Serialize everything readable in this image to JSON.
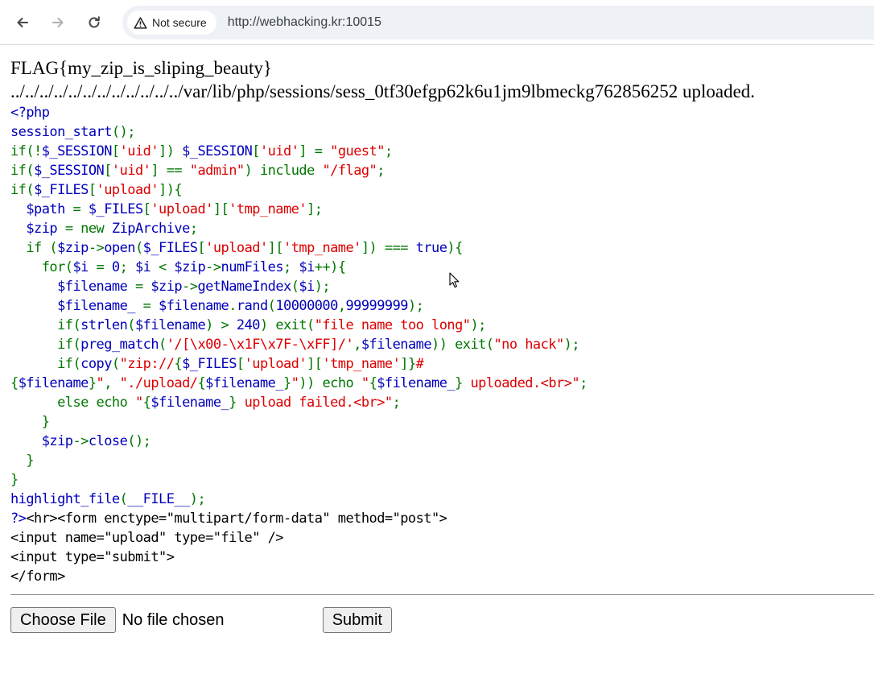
{
  "browser": {
    "security_label": "Not secure",
    "url": "http://webhacking.kr:10015",
    "icons": [
      "back-arrow-icon",
      "forward-arrow-icon",
      "reload-icon",
      "warning-triangle-icon"
    ]
  },
  "page": {
    "flag": "FLAG{my_zip_is_sliping_beauty}",
    "upload_message": "../../../../../../../../../../../../var/lib/php/sessions/sess_0tf30efgp62k6u1jm9lbmeckg762856252 uploaded."
  },
  "source_lines": [
    [
      {
        "c": "default",
        "t": "<?php"
      }
    ],
    [
      {
        "c": "default",
        "t": "session_start"
      },
      {
        "c": "keyword",
        "t": "();"
      }
    ],
    [
      {
        "c": "keyword",
        "t": "if(!"
      },
      {
        "c": "default",
        "t": "$_SESSION"
      },
      {
        "c": "keyword",
        "t": "["
      },
      {
        "c": "string",
        "t": "'uid'"
      },
      {
        "c": "keyword",
        "t": "]) "
      },
      {
        "c": "default",
        "t": "$_SESSION"
      },
      {
        "c": "keyword",
        "t": "["
      },
      {
        "c": "string",
        "t": "'uid'"
      },
      {
        "c": "keyword",
        "t": "] = "
      },
      {
        "c": "string",
        "t": "\"guest\""
      },
      {
        "c": "keyword",
        "t": ";"
      }
    ],
    [
      {
        "c": "keyword",
        "t": "if("
      },
      {
        "c": "default",
        "t": "$_SESSION"
      },
      {
        "c": "keyword",
        "t": "["
      },
      {
        "c": "string",
        "t": "'uid'"
      },
      {
        "c": "keyword",
        "t": "] == "
      },
      {
        "c": "string",
        "t": "\"admin\""
      },
      {
        "c": "keyword",
        "t": ") include "
      },
      {
        "c": "string",
        "t": "\"/flag\""
      },
      {
        "c": "keyword",
        "t": ";"
      }
    ],
    [
      {
        "c": "keyword",
        "t": "if("
      },
      {
        "c": "default",
        "t": "$_FILES"
      },
      {
        "c": "keyword",
        "t": "["
      },
      {
        "c": "string",
        "t": "'upload'"
      },
      {
        "c": "keyword",
        "t": "]){"
      }
    ],
    [
      {
        "c": "keyword",
        "t": "  "
      },
      {
        "c": "default",
        "t": "$path "
      },
      {
        "c": "keyword",
        "t": "= "
      },
      {
        "c": "default",
        "t": "$_FILES"
      },
      {
        "c": "keyword",
        "t": "["
      },
      {
        "c": "string",
        "t": "'upload'"
      },
      {
        "c": "keyword",
        "t": "]["
      },
      {
        "c": "string",
        "t": "'tmp_name'"
      },
      {
        "c": "keyword",
        "t": "];"
      }
    ],
    [
      {
        "c": "keyword",
        "t": "  "
      },
      {
        "c": "default",
        "t": "$zip "
      },
      {
        "c": "keyword",
        "t": "= new "
      },
      {
        "c": "default",
        "t": "ZipArchive"
      },
      {
        "c": "keyword",
        "t": ";"
      }
    ],
    [
      {
        "c": "keyword",
        "t": "  if ("
      },
      {
        "c": "default",
        "t": "$zip"
      },
      {
        "c": "keyword",
        "t": "->"
      },
      {
        "c": "default",
        "t": "open"
      },
      {
        "c": "keyword",
        "t": "("
      },
      {
        "c": "default",
        "t": "$_FILES"
      },
      {
        "c": "keyword",
        "t": "["
      },
      {
        "c": "string",
        "t": "'upload'"
      },
      {
        "c": "keyword",
        "t": "]["
      },
      {
        "c": "string",
        "t": "'tmp_name'"
      },
      {
        "c": "keyword",
        "t": "]) === "
      },
      {
        "c": "default",
        "t": "true"
      },
      {
        "c": "keyword",
        "t": "){"
      }
    ],
    [
      {
        "c": "keyword",
        "t": "    for("
      },
      {
        "c": "default",
        "t": "$i "
      },
      {
        "c": "keyword",
        "t": "= "
      },
      {
        "c": "default",
        "t": "0"
      },
      {
        "c": "keyword",
        "t": "; "
      },
      {
        "c": "default",
        "t": "$i "
      },
      {
        "c": "keyword",
        "t": "< "
      },
      {
        "c": "default",
        "t": "$zip"
      },
      {
        "c": "keyword",
        "t": "->"
      },
      {
        "c": "default",
        "t": "numFiles"
      },
      {
        "c": "keyword",
        "t": "; "
      },
      {
        "c": "default",
        "t": "$i"
      },
      {
        "c": "keyword",
        "t": "++){"
      }
    ],
    [
      {
        "c": "keyword",
        "t": "      "
      },
      {
        "c": "default",
        "t": "$filename "
      },
      {
        "c": "keyword",
        "t": "= "
      },
      {
        "c": "default",
        "t": "$zip"
      },
      {
        "c": "keyword",
        "t": "->"
      },
      {
        "c": "default",
        "t": "getNameIndex"
      },
      {
        "c": "keyword",
        "t": "("
      },
      {
        "c": "default",
        "t": "$i"
      },
      {
        "c": "keyword",
        "t": ");"
      }
    ],
    [
      {
        "c": "keyword",
        "t": "      "
      },
      {
        "c": "default",
        "t": "$filename_ "
      },
      {
        "c": "keyword",
        "t": "= "
      },
      {
        "c": "default",
        "t": "$filename"
      },
      {
        "c": "keyword",
        "t": "."
      },
      {
        "c": "default",
        "t": "rand"
      },
      {
        "c": "keyword",
        "t": "("
      },
      {
        "c": "default",
        "t": "10000000"
      },
      {
        "c": "keyword",
        "t": ","
      },
      {
        "c": "default",
        "t": "99999999"
      },
      {
        "c": "keyword",
        "t": ");"
      }
    ],
    [
      {
        "c": "keyword",
        "t": "      if("
      },
      {
        "c": "default",
        "t": "strlen"
      },
      {
        "c": "keyword",
        "t": "("
      },
      {
        "c": "default",
        "t": "$filename"
      },
      {
        "c": "keyword",
        "t": ") > "
      },
      {
        "c": "default",
        "t": "240"
      },
      {
        "c": "keyword",
        "t": ") exit("
      },
      {
        "c": "string",
        "t": "\"file name too long\""
      },
      {
        "c": "keyword",
        "t": ");"
      }
    ],
    [
      {
        "c": "keyword",
        "t": "      if("
      },
      {
        "c": "default",
        "t": "preg_match"
      },
      {
        "c": "keyword",
        "t": "("
      },
      {
        "c": "string",
        "t": "'/[\\x00-\\x1F\\x7F-\\xFF]/'"
      },
      {
        "c": "keyword",
        "t": ","
      },
      {
        "c": "default",
        "t": "$filename"
      },
      {
        "c": "keyword",
        "t": ")) exit("
      },
      {
        "c": "string",
        "t": "\"no hack\""
      },
      {
        "c": "keyword",
        "t": ");"
      }
    ],
    [
      {
        "c": "keyword",
        "t": "      if("
      },
      {
        "c": "default",
        "t": "copy"
      },
      {
        "c": "keyword",
        "t": "("
      },
      {
        "c": "string",
        "t": "\"zip://"
      },
      {
        "c": "keyword",
        "t": "{"
      },
      {
        "c": "default",
        "t": "$_FILES"
      },
      {
        "c": "keyword",
        "t": "["
      },
      {
        "c": "string",
        "t": "'upload'"
      },
      {
        "c": "keyword",
        "t": "]["
      },
      {
        "c": "string",
        "t": "'tmp_name'"
      },
      {
        "c": "keyword",
        "t": "]}"
      },
      {
        "c": "string",
        "t": "#"
      }
    ],
    [
      {
        "c": "keyword",
        "t": "{"
      },
      {
        "c": "default",
        "t": "$filename"
      },
      {
        "c": "keyword",
        "t": "}"
      },
      {
        "c": "string",
        "t": "\""
      },
      {
        "c": "keyword",
        "t": ", "
      },
      {
        "c": "string",
        "t": "\"./upload/"
      },
      {
        "c": "keyword",
        "t": "{"
      },
      {
        "c": "default",
        "t": "$filename_"
      },
      {
        "c": "keyword",
        "t": "}"
      },
      {
        "c": "string",
        "t": "\""
      },
      {
        "c": "keyword",
        "t": ")) echo "
      },
      {
        "c": "string",
        "t": "\""
      },
      {
        "c": "keyword",
        "t": "{"
      },
      {
        "c": "default",
        "t": "$filename_"
      },
      {
        "c": "keyword",
        "t": "}"
      },
      {
        "c": "string",
        "t": " uploaded.<br>\""
      },
      {
        "c": "keyword",
        "t": ";"
      }
    ],
    [
      {
        "c": "keyword",
        "t": "      else echo "
      },
      {
        "c": "string",
        "t": "\""
      },
      {
        "c": "keyword",
        "t": "{"
      },
      {
        "c": "default",
        "t": "$filename_"
      },
      {
        "c": "keyword",
        "t": "}"
      },
      {
        "c": "string",
        "t": " upload failed.<br>\""
      },
      {
        "c": "keyword",
        "t": ";"
      }
    ],
    [
      {
        "c": "keyword",
        "t": "    }"
      }
    ],
    [
      {
        "c": "keyword",
        "t": "    "
      },
      {
        "c": "default",
        "t": "$zip"
      },
      {
        "c": "keyword",
        "t": "->"
      },
      {
        "c": "default",
        "t": "close"
      },
      {
        "c": "keyword",
        "t": "();"
      }
    ],
    [
      {
        "c": "keyword",
        "t": "  }"
      }
    ],
    [
      {
        "c": "keyword",
        "t": "}"
      }
    ],
    [
      {
        "c": "default",
        "t": "highlight_file"
      },
      {
        "c": "keyword",
        "t": "("
      },
      {
        "c": "default",
        "t": "__FILE__"
      },
      {
        "c": "keyword",
        "t": ");"
      }
    ],
    [
      {
        "c": "default",
        "t": "?>"
      },
      {
        "c": "html",
        "t": "<hr><form enctype=\"multipart/form-data\" method=\"post\">"
      }
    ],
    [
      {
        "c": "html",
        "t": "<input name=\"upload\" type=\"file\" />"
      }
    ],
    [
      {
        "c": "html",
        "t": "<input type=\"submit\">"
      }
    ],
    [
      {
        "c": "html",
        "t": "</form>"
      }
    ]
  ],
  "form": {
    "choose_file_label": "Choose File",
    "file_status": "No file chosen",
    "submit_label": "Submit"
  },
  "colors": {
    "php_default": "#0000bb",
    "php_keyword": "#007700",
    "php_string": "#dd0000",
    "php_html": "#000000"
  }
}
